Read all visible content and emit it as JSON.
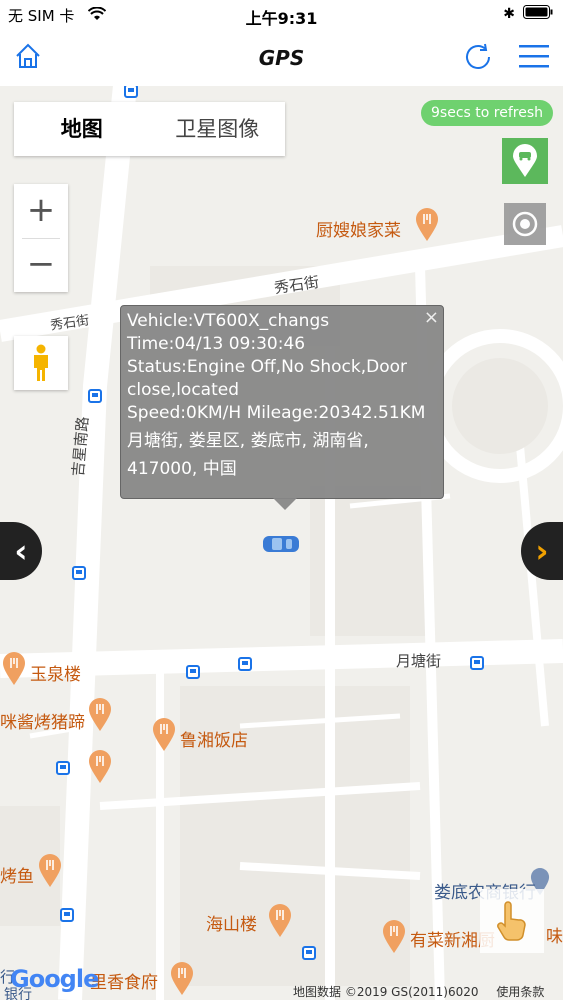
{
  "status_bar": {
    "carrier": "无 SIM 卡",
    "time": "上午9:31"
  },
  "navbar": {
    "title": "GPS"
  },
  "map_controls": {
    "map_type_tabs": [
      "地图",
      "卫星图像"
    ],
    "active_tab": "地图",
    "refresh_countdown": "9secs to refresh",
    "zoom_in": "+",
    "zoom_out": "−"
  },
  "info_window": {
    "close": "×",
    "vehicle": "Vehicle:VT600X_changs",
    "time": "Time:04/13 09:30:46",
    "status": "Status:Engine Off,No Shock,Door close,located",
    "speed_mileage": "Speed:0KM/H Mileage:20342.51KM",
    "address": "月塘街, 娄星区, 娄底市, 湖南省, 417000, 中国"
  },
  "map_labels": {
    "restaurant_1": "厨嫂娘家菜",
    "street_1": "秀石街",
    "street_2": "秀石街",
    "road_1": "吉星南路",
    "street_3": "月塘街",
    "poi_yuquan": "玉泉楼",
    "poi_zhutizhu": "咪酱烤猪蹄",
    "poi_luxiang": "鲁湘饭店",
    "poi_kaoyu": "烤鱼",
    "bank": "娄底农商银行",
    "poi_haishan": "海山楼",
    "poi_youcai": "有菜新湘厨",
    "poi_weixiang": "味",
    "poi_lixiang": "里香食府",
    "poi_hang": "行",
    "poi_yinhang": "银行"
  },
  "footer": {
    "google_logo": "Google",
    "map_data": "地图数据 ©2019 GS(2011)6020",
    "terms": "使用条款"
  },
  "colors": {
    "refresh_badge": "#6fd16f",
    "locate_button": "#5cb85c",
    "icon_blue": "#1a73e8",
    "poi_orange": "#f0a060"
  }
}
